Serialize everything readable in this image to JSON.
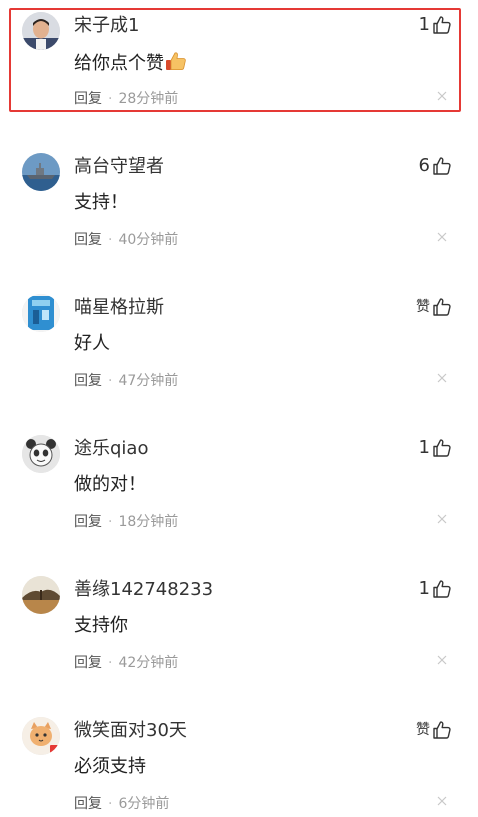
{
  "reply_label": "回复",
  "separator": "·",
  "zan_label": "赞",
  "comments": [
    {
      "username": "宋子成1",
      "content": "给你点个赞",
      "has_thumb_emoji": true,
      "likes": "1",
      "time": "28分钟前",
      "highlighted": true,
      "avatar": "man-portrait"
    },
    {
      "username": "高台守望者",
      "content": "支持！",
      "likes": "6",
      "time": "40分钟前",
      "avatar": "warship"
    },
    {
      "username": "喵星格拉斯",
      "content": "好人",
      "likes": "",
      "time": "47分钟前",
      "avatar": "blue-poster"
    },
    {
      "username": "途乐qiao",
      "content": "做的对！",
      "likes": "1",
      "time": "18分钟前",
      "avatar": "panda-doodle"
    },
    {
      "username": "善缘142748233",
      "content": "支持你",
      "likes": "1",
      "time": "42分钟前",
      "avatar": "landscape-tree"
    },
    {
      "username": "微笑面对30天",
      "content": "必须支持",
      "likes": "",
      "time": "6分钟前",
      "avatar": "orange-cat"
    }
  ],
  "colors": {
    "highlight_border": "#e53935",
    "text_primary": "#333333",
    "text_meta": "#9a9a9a"
  }
}
